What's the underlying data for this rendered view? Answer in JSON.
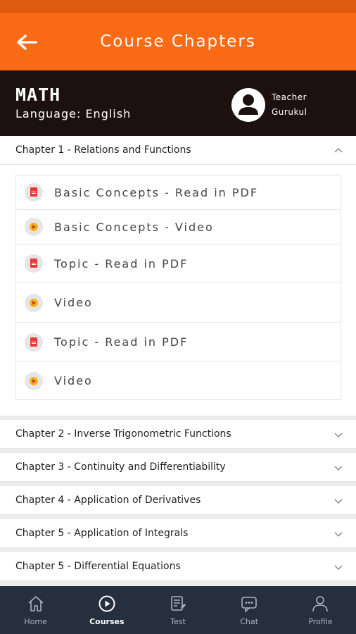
{
  "app": {
    "title": "Course Chapters"
  },
  "course": {
    "subject": "MATH",
    "language": "Language: English",
    "teacher_line1": "Teacher",
    "teacher_line2": "Gurukul"
  },
  "chapters": [
    {
      "title": "Chapter 1 - Relations and Functions",
      "expanded": true,
      "lessons": [
        {
          "label": "Basic Concepts - Read in PDF",
          "icon": "pdf-icon"
        },
        {
          "label": "Basic Concepts - Video",
          "icon": "play-icon"
        },
        {
          "label": "Topic - Read in PDF",
          "icon": "pdf-icon"
        },
        {
          "label": "Video",
          "icon": "play-icon"
        },
        {
          "label": "Topic - Read in PDF",
          "icon": "pdf-icon"
        },
        {
          "label": "Video",
          "icon": "play-icon"
        }
      ]
    },
    {
      "title": "Chapter 2 - Inverse Trigonometric Functions",
      "expanded": false
    },
    {
      "title": "Chapter 3 - Continuity and Differentiability",
      "expanded": false
    },
    {
      "title": "Chapter 4 - Application of Derivatives",
      "expanded": false
    },
    {
      "title": "Chapter 5 - Application of Integrals",
      "expanded": false
    },
    {
      "title": "Chapter 5 - Differential Equations",
      "expanded": false
    }
  ],
  "nav": [
    {
      "label": "Home",
      "icon": "home-icon",
      "active": false
    },
    {
      "label": "Courses",
      "icon": "play-circle-icon",
      "active": true
    },
    {
      "label": "Test",
      "icon": "test-icon",
      "active": false
    },
    {
      "label": "Chat",
      "icon": "chat-icon",
      "active": false
    },
    {
      "label": "Profile",
      "icon": "profile-icon",
      "active": false
    }
  ],
  "colors": {
    "appbar": "#fb6a14",
    "statusbar": "#dd5a10",
    "course_banner": "#1d1010",
    "bottom_nav": "#262f3d",
    "pdf": "#e53935",
    "play": "#f6b21b"
  }
}
